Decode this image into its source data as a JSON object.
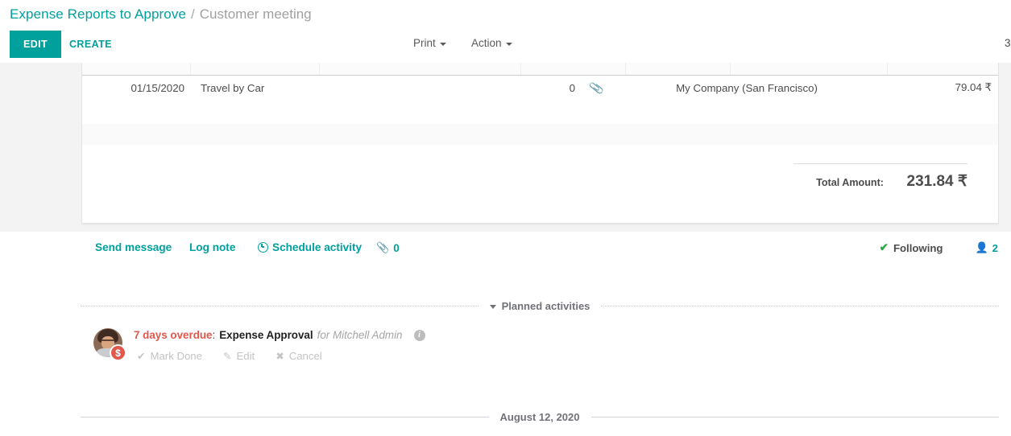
{
  "breadcrumb": {
    "root": "Expense Reports to Approve",
    "separator": "/",
    "current": "Customer meeting"
  },
  "control_panel": {
    "edit_label": "EDIT",
    "create_label": "CREATE",
    "print_label": "Print",
    "action_label": "Action",
    "pager": "3"
  },
  "expense_lines": {
    "row": {
      "date": "01/15/2020",
      "name": "Travel by Car",
      "quantity": "0",
      "attachment_icon": "paperclip-icon",
      "company": "My Company (San Francisco)",
      "amount": "79.04 ₹"
    }
  },
  "totals": {
    "label": "Total Amount:",
    "value": "231.84 ₹"
  },
  "chatter": {
    "send_message": "Send message",
    "log_note": "Log note",
    "schedule_activity": "Schedule activity",
    "schedule_icon": "clock-icon",
    "attachment_icon": "paperclip-icon",
    "attachment_count": "0",
    "following_label": "Following",
    "following_icon": "check-icon",
    "followers_icon": "person-icon",
    "followers_count": "2",
    "planned_activities_label": "Planned activities",
    "date_separator": "August 12, 2020"
  },
  "activity": {
    "avatar_icon": "avatar",
    "badge_icon": "dollar-badge-icon",
    "overdue": "7 days overdue",
    "colon": ":",
    "summary": "Expense Approval",
    "assignee": "for Mitchell Admin",
    "info_icon": "info-icon",
    "mark_done": "Mark Done",
    "edit": "Edit",
    "cancel": "Cancel",
    "mark_done_icon": "check-icon",
    "edit_icon": "pencil-icon",
    "cancel_icon": "close-icon"
  },
  "colors": {
    "accent": "#00a09d",
    "overdue": "#e2574c",
    "following_check": "#28a745",
    "page_bg": "#f3f3f3"
  }
}
